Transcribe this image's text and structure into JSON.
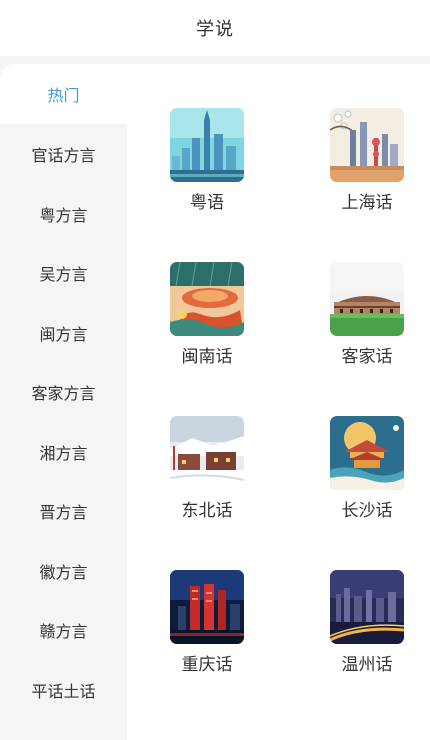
{
  "header": {
    "title": "学说"
  },
  "sidebar": {
    "items": [
      {
        "label": "热门"
      },
      {
        "label": "官话方言"
      },
      {
        "label": "粤方言"
      },
      {
        "label": "吴方言"
      },
      {
        "label": "闽方言"
      },
      {
        "label": "客家方言"
      },
      {
        "label": "湘方言"
      },
      {
        "label": "晋方言"
      },
      {
        "label": "徽方言"
      },
      {
        "label": "赣方言"
      },
      {
        "label": "平话土话"
      }
    ],
    "active_index": 0,
    "active_color": "#3b9be6"
  },
  "grid": {
    "items": [
      {
        "label": "粤语",
        "icon": "guangzhou-city-icon"
      },
      {
        "label": "上海话",
        "icon": "shanghai-skyline-icon"
      },
      {
        "label": "闽南话",
        "icon": "tulou-illustration-icon"
      },
      {
        "label": "客家话",
        "icon": "hakka-tulou-icon"
      },
      {
        "label": "东北话",
        "icon": "snowy-town-icon"
      },
      {
        "label": "长沙话",
        "icon": "changsha-pavilion-icon"
      },
      {
        "label": "重庆话",
        "icon": "chongqing-night-icon"
      },
      {
        "label": "温州话",
        "icon": "wenzhou-night-icon"
      }
    ]
  }
}
